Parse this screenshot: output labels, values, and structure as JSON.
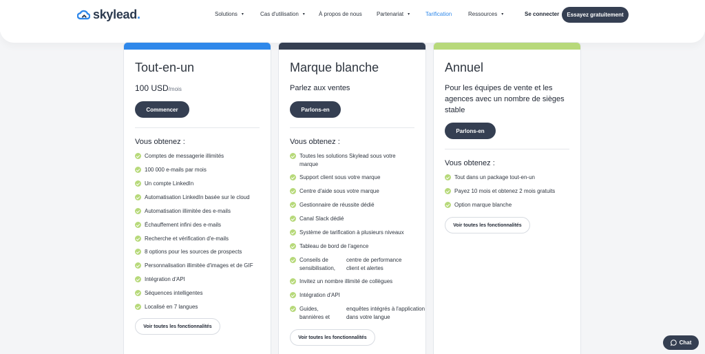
{
  "brand": {
    "name": "skylead",
    "dot": ".",
    "accent": "#2f88ea",
    "dark": "#353f52"
  },
  "nav": {
    "items": [
      {
        "label": "Solutions",
        "dropdown": true
      },
      {
        "label": "Cas d'utilisation",
        "dropdown": true
      },
      {
        "label": "À propos de nous",
        "dropdown": false
      },
      {
        "label": "Partenariat",
        "dropdown": true
      },
      {
        "label": "Tarification",
        "dropdown": false,
        "active": true
      },
      {
        "label": "Ressources",
        "dropdown": true
      }
    ],
    "caret": "▾",
    "login": "Se connecter",
    "cta": "Essayez gratuitement"
  },
  "cards": [
    {
      "title": "Tout-en-un",
      "price": "100 USD",
      "price_unit": "/mois",
      "button": "Commencer",
      "obtain": "Vous obtenez :",
      "stripe_color": "#2f88ea",
      "features": [
        "Comptes de messagerie illimités",
        "100 000 e-mails par mois",
        "Un compte LinkedIn",
        "Automatisation LinkedIn basée sur le cloud",
        "Automatisation illimitée des e-mails",
        "Échauffement infini des e-mails",
        "Recherche et vérification d'e-mails",
        "8 options pour les sources de prospects",
        "Personnalisation illimitée d'images et de GIF",
        "Intégration d'API",
        "Séquences intelligentes",
        "Localisé en 7 langues"
      ],
      "see_all": "Voir toutes les fonctionnalités"
    },
    {
      "title": "Marque blanche",
      "subtitle": "Parlez aux ventes",
      "button": "Parlons-en",
      "obtain": "Vous obtenez :",
      "stripe_color": "#353f52",
      "features": [
        "Toutes les solutions Skylead sous votre marque",
        "Support client sous votre marque",
        "Centre d'aide sous votre marque",
        "Gestionnaire de réussite dédié",
        "Canal Slack dédié",
        "Système de tarification à plusieurs niveaux",
        "Tableau de bord de l'agence",
        [
          "Conseils de sensibilisation,",
          "centre de performance client et alertes"
        ],
        "Invitez un nombre illimité de collègues",
        "Intégration d'API",
        [
          "Guides, bannières et",
          "enquêtes intégrés à l'application dans votre langue"
        ]
      ],
      "see_all": "Voir toutes les fonctionnalités"
    },
    {
      "title": "Annuel",
      "subtitle": "Pour les équipes de vente et les agences avec un nombre de sièges stable",
      "button": "Parlons-en",
      "obtain": "Vous obtenez :",
      "stripe_color": "#b7d97a",
      "features": [
        "Tout dans un package tout-en-un",
        "Payez 10 mois et obtenez 2 mois gratuits",
        "Option marque blanche"
      ],
      "see_all": "Voir toutes les fonctionnalités"
    }
  ],
  "chat": {
    "label": "Chat"
  }
}
